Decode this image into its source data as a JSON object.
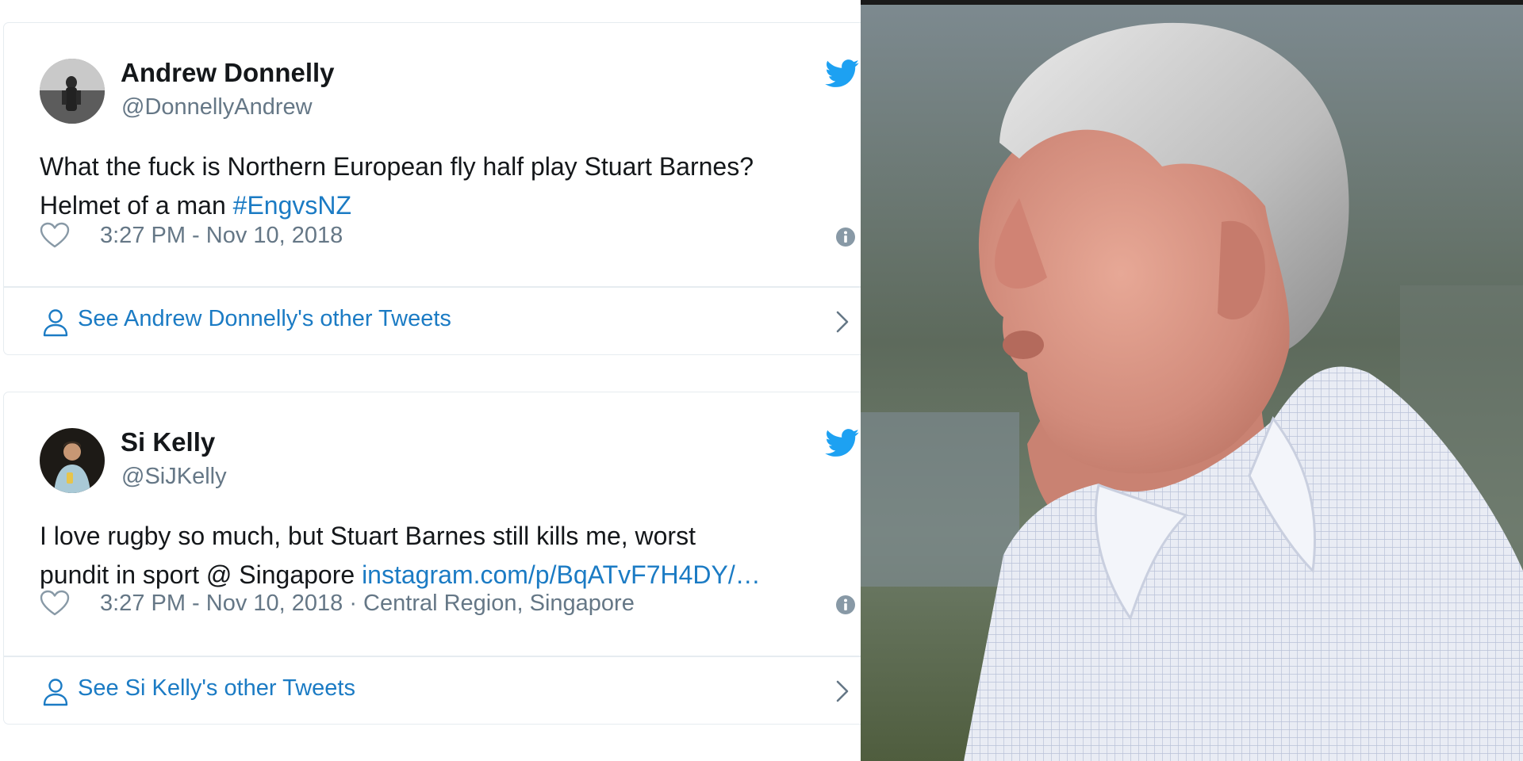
{
  "tweets": [
    {
      "name": "Andrew Donnelly",
      "handle": "@DonnellyAndrew",
      "text_line1": "What the fuck is Northern European fly half play Stuart Barnes?",
      "text_line2_pre": "Helmet of a man ",
      "text_link": "#EngvsNZ",
      "timestamp": "3:27 PM - Nov 10, 2018",
      "see_more": "See Andrew Donnelly's other Tweets"
    },
    {
      "name": "Si Kelly",
      "handle": "@SiJKelly",
      "text_line1": "I love rugby so much, but Stuart Barnes still kills me, worst",
      "text_line2_pre": "pundit in sport @ Singapore ",
      "text_link": "instagram.com/p/BqATvF7H4DY/…",
      "timestamp": "3:27 PM - Nov 10, 2018 · Central Region, Singapore",
      "see_more": "See Si Kelly's other Tweets"
    }
  ],
  "icons": {
    "brand": "twitter-bird-icon",
    "like": "heart-icon",
    "info": "info-icon",
    "profile": "person-icon",
    "more": "chevron-right-icon"
  },
  "colors": {
    "link": "#1b7bc4",
    "twitter_blue": "#1da1f2",
    "muted": "#657786",
    "text": "#14171a",
    "border": "#e6ecf0"
  }
}
